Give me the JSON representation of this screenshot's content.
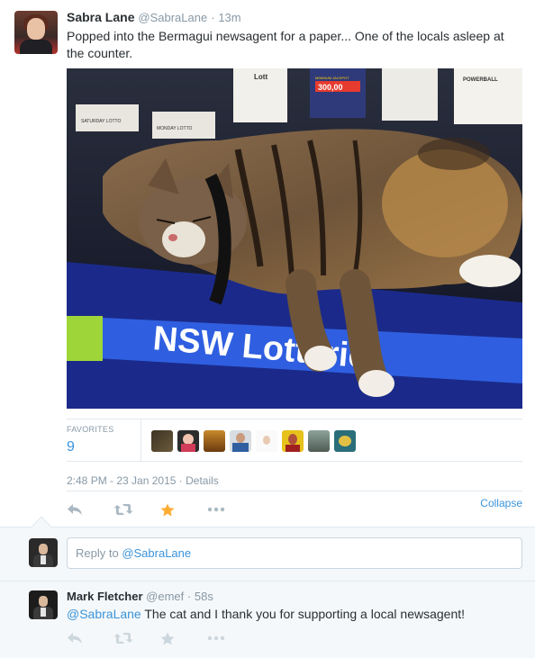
{
  "tweet": {
    "fullname": "Sabra Lane",
    "username": "@SabraLane",
    "dot": "·",
    "time": "13m",
    "text": "Popped into the Bermagui newsagent for a paper... One of the locals asleep at the counter.",
    "photo_signs": {
      "saturday_lotto": "SATURDAY LOTTO\nRESULTS",
      "monday_lotto": "MONDAY LOTTO\nRESULTS",
      "lotto": "Lott",
      "jackpot": "MINIMUM JACKPOT",
      "jackpot_value": "300,00",
      "powerball": "POWERBALL",
      "counter_text": "NSW Lotterie"
    },
    "favorites_label": "FAVORITES",
    "favorites_count": "9",
    "timestamp": "2:48 PM - 23 Jan 2015",
    "details_sep": "·",
    "details_label": "Details",
    "collapse_label": "Collapse"
  },
  "reply_box": {
    "prefix": "Reply to ",
    "mention": "@SabraLane"
  },
  "reply": {
    "fullname": "Mark Fletcher",
    "username": "@emef",
    "dot": "·",
    "time": "58s",
    "mention": "@SabraLane",
    "text": " The cat and I thank you for supporting a local newsagent!"
  },
  "icons": {
    "reply": "reply-icon",
    "retweet": "retweet-icon",
    "favorite": "star-icon",
    "more": "more-icon"
  },
  "colors": {
    "link_blue": "#3b94d9",
    "favorite_gold": "#ffac33",
    "muted_gray": "#8899a6",
    "reply_area_bg": "#f5f8fa"
  }
}
